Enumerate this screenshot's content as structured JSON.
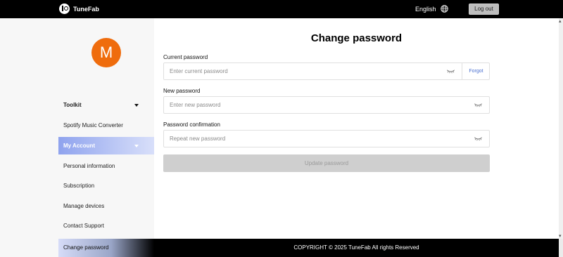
{
  "header": {
    "brand": "TuneFab",
    "language": "English",
    "logout_label": "Log out"
  },
  "profile": {
    "avatar_letter": "M",
    "avatar_color": "#ef6c0d"
  },
  "sidebar": {
    "items": [
      {
        "label": "Toolkit"
      },
      {
        "label": "Spotify Music Converter"
      },
      {
        "label": "My Account"
      },
      {
        "label": "Personal information"
      },
      {
        "label": "Subscription"
      },
      {
        "label": "Manage devices"
      },
      {
        "label": "Contact Support"
      },
      {
        "label": "Change password"
      }
    ]
  },
  "form": {
    "title": "Change password",
    "current": {
      "label": "Current password",
      "placeholder": "Enter current password",
      "value": ""
    },
    "forgot_label": "Forgot",
    "new": {
      "label": "New password",
      "placeholder": "Enter new password",
      "value": ""
    },
    "confirm": {
      "label": "Password confirmation",
      "placeholder": "Repeat new password",
      "value": ""
    },
    "submit_label": "Update password"
  },
  "footer": {
    "copyright": "COPYRIGHT © 2025 TuneFab All rights Reserved"
  }
}
